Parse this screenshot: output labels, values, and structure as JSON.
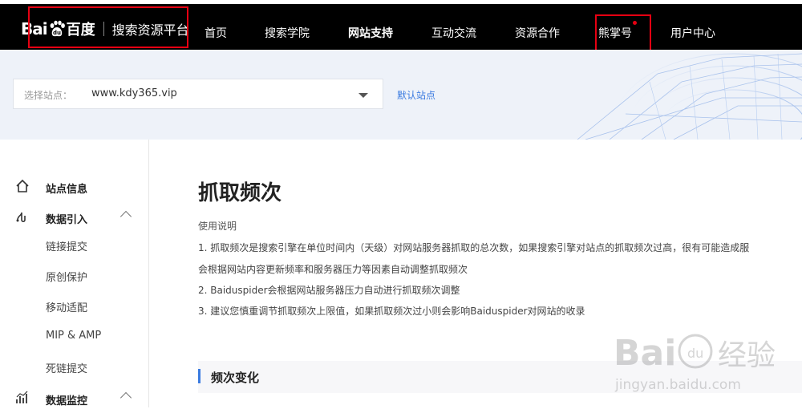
{
  "header": {
    "logo": {
      "bai": "Bai",
      "du": "百度",
      "platform": "搜索资源平台"
    },
    "nav": [
      "首页",
      "搜索学院",
      "网站支持",
      "互动交流",
      "资源合作",
      "熊掌号",
      "用户中心"
    ]
  },
  "site_selector": {
    "label": "选择站点：",
    "value": "www.kdy365.vip",
    "default_link": "默认站点"
  },
  "sidebar": {
    "sections": [
      {
        "label": "站点信息",
        "icon": "home-icon"
      },
      {
        "label": "数据引入",
        "icon": "data-import-icon",
        "items": [
          "链接提交",
          "原创保护",
          "移动适配",
          "MIP & AMP",
          "死链提交"
        ]
      },
      {
        "label": "数据监控",
        "icon": "chart-icon"
      }
    ]
  },
  "main": {
    "title": "抓取频次",
    "usage_title": "使用说明",
    "lines": [
      "1. 抓取频次是搜索引擎在单位时间内（天级）对网站服务器抓取的总次数，如果搜索引擎对站点的抓取频次过高，很有可能造成服",
      "会根据网站内容更新频率和服务器压力等因素自动调整抓取频次",
      "2. Baiduspider会根据网站服务器压力自动进行抓取频次调整",
      "3. 建议您慎重调节抓取频次上限值，如果抓取频次过小则会影响Baiduspider对网站的收录"
    ],
    "section_title": "频次变化"
  },
  "watermark": {
    "brand": "Bai du 经验",
    "url": "jingyan.baidu.com"
  },
  "colors": {
    "accent": "#3b7be0",
    "highlight": "#e60012",
    "topbar": "#000000"
  }
}
